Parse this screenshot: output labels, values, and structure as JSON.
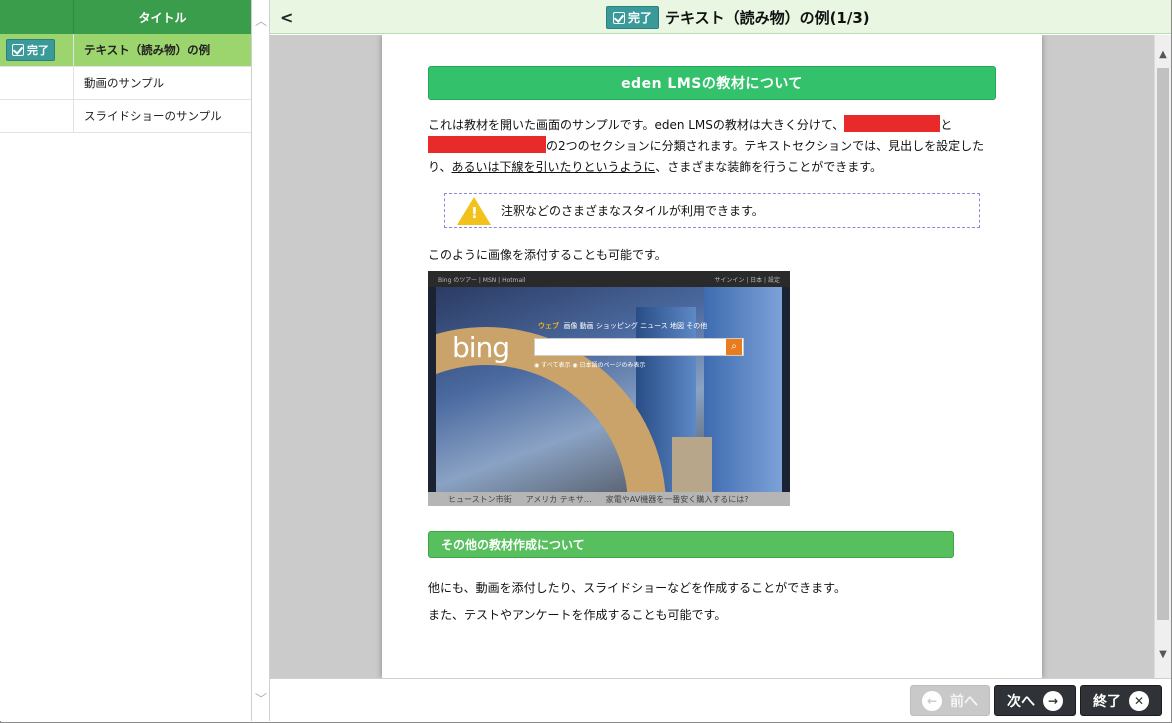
{
  "sidebar": {
    "header_title": "タイトル",
    "items": [
      {
        "label": "テキスト（読み物）の例",
        "status": "完了",
        "active": true
      },
      {
        "label": "動画のサンプル",
        "status": "",
        "active": false
      },
      {
        "label": "スライドショーのサンプル",
        "status": "",
        "active": false
      }
    ]
  },
  "header": {
    "back_label": "<",
    "status_badge": "完了",
    "title": "テキスト（読み物）の例(1/3)"
  },
  "content": {
    "section1_title": "eden LMSの教材について",
    "para1_part1": "これは教材を開いた画面のサンプルです。eden LMSの教材は大きく分けて、",
    "para1_part2": "と",
    "para1_part3": "の2つのセクションに分類されます。テキストセクションでは、見出しを設定したり、",
    "para1_underlined": "あるいは下線を引いたりというように",
    "para1_part4": "、さまざまな装飾を行うことができます。",
    "note_text": "注釈などのさまざまなスタイルが利用できます。",
    "image_caption": "このように画像を添付することも可能です。",
    "image": {
      "topbar_left": "Bing のツアー  |  MSN  |  Hotmail",
      "topbar_right": "サインイン  |  日本  |  設定",
      "logo": "bing",
      "nav_active": "ウェブ",
      "nav_rest": "画像  動画  ショッピング  ニュース  地図  その他",
      "options": "◉ すべて表示    ◉ 日本語のページのみ表示",
      "bottom_1": "ヒューストン市街",
      "bottom_2": "アメリカ テキサ…",
      "bottom_3": "家電やAV機器を一番安く購入するには?"
    },
    "section2_title": "その他の教材作成について",
    "para2": "他にも、動画を添付したり、スライドショーなどを作成することができます。",
    "para3": "また、テストやアンケートを作成することも可能です。"
  },
  "footer": {
    "prev_label": "前へ",
    "next_label": "次へ",
    "end_label": "終了"
  },
  "colors": {
    "sidebar_header": "#3a9d4c",
    "active_row": "#9cd46d",
    "section_title": "#33c16b",
    "redaction": "#e82a2a",
    "badge": "#3a9a9a"
  }
}
